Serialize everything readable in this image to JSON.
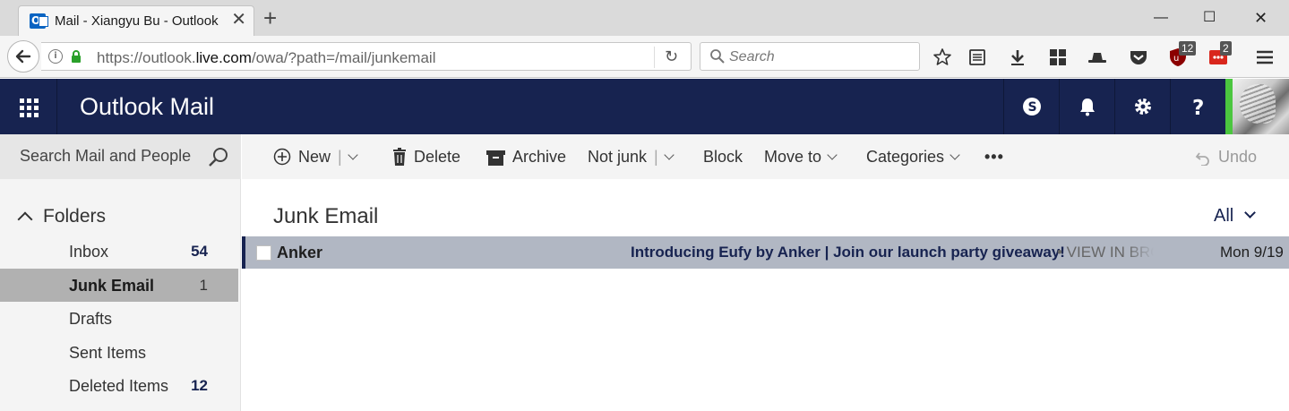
{
  "browser": {
    "tab_title": "Mail - Xiangyu Bu - Outlook",
    "tab_close": "✕",
    "new_tab": "+",
    "url_prefix": "https://outlook.",
    "url_domain": "live.com",
    "url_path": "/owa/?path=/mail/junkemail",
    "search_placeholder": "Search",
    "badge_ublock": "12",
    "badge_ext": "2",
    "window_controls": {
      "minimize": "—",
      "maximize": "☐",
      "close": "✕"
    }
  },
  "header": {
    "app_title": "Outlook Mail",
    "accent_color": "#172350",
    "presence_color": "#4bc63f"
  },
  "left_pane": {
    "search_label": "Search Mail and People",
    "folders_label": "Folders",
    "folders": [
      {
        "name": "Inbox",
        "count": "54",
        "selected": false,
        "bold_count": true
      },
      {
        "name": "Junk Email",
        "count": "1",
        "selected": true,
        "bold_count": false
      },
      {
        "name": "Drafts",
        "count": "",
        "selected": false,
        "bold_count": false
      },
      {
        "name": "Sent Items",
        "count": "",
        "selected": false,
        "bold_count": false
      },
      {
        "name": "Deleted Items",
        "count": "12",
        "selected": false,
        "bold_count": true
      }
    ]
  },
  "command_bar": {
    "new": "New",
    "delete": "Delete",
    "archive": "Archive",
    "not_junk": "Not junk",
    "block": "Block",
    "move_to": "Move to",
    "categories": "Categories",
    "more": "•••",
    "undo": "Undo",
    "separator": "|"
  },
  "message_list": {
    "title": "Junk Email",
    "filter": "All",
    "messages": [
      {
        "sender": "Anker",
        "subject": "Introducing Eufy by Anker | Join our launch party giveaway!",
        "preview": "• VIEW IN BRO",
        "date": "Mon 9/19",
        "selected": true
      }
    ]
  }
}
